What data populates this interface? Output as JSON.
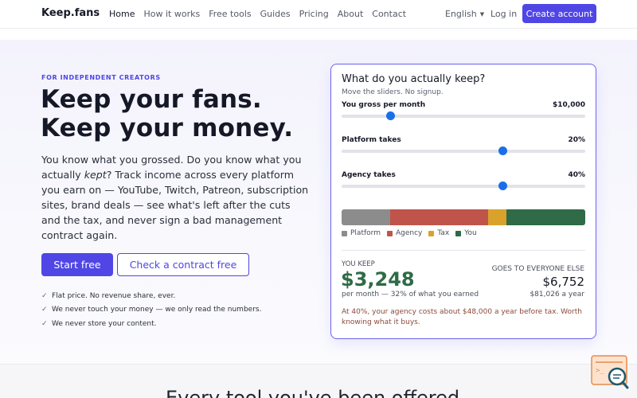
{
  "nav": {
    "logo": "Keep.fans",
    "links": [
      "Home",
      "How it works",
      "Free tools",
      "Guides",
      "Pricing",
      "About",
      "Contact"
    ],
    "language": "English",
    "login": "Log in",
    "create_account": "Create account"
  },
  "hero": {
    "eyebrow": "FOR INDEPENDENT CREATORS",
    "headline_line1": "Keep your fans.",
    "headline_line2": "Keep your money.",
    "body_part1": "You know what you grossed. Do you know what you actually ",
    "body_em": "kept",
    "body_part2": "? Track income across every platform you earn on — YouTube, Twitch, Patreon, subscription sites, brand deals — see what's left after the cuts and the tax, and never sign a bad management contract again.",
    "primary_cta": "Start free",
    "secondary_cta": "Check a contract free",
    "checks": [
      "Flat price. No revenue share, ever.",
      "We never touch your money — we only read the numbers.",
      "We never store your content."
    ]
  },
  "calculator": {
    "title": "What do you actually keep?",
    "subtitle": "Move the sliders. No signup.",
    "sliders": [
      {
        "label": "You gross per month",
        "value_text": "$10,000",
        "fraction": 0.2
      },
      {
        "label": "Platform takes",
        "value_text": "20%",
        "fraction": 0.661
      },
      {
        "label": "Agency takes",
        "value_text": "40%",
        "fraction": 0.661
      }
    ],
    "breakdown": [
      {
        "name": "Platform",
        "amount": 2000,
        "color": "#8c8c8c"
      },
      {
        "name": "Agency",
        "amount": 4000,
        "color": "#c0544a"
      },
      {
        "name": "Tax",
        "amount": 752,
        "color": "#d9a22b"
      },
      {
        "name": "You",
        "amount": 3248,
        "color": "#2e6b46"
      }
    ],
    "keep_label": "YOU KEEP",
    "keep_amount": "$3,248",
    "keep_note": "per month — 32% of what you earned",
    "else_label": "GOES TO EVERYONE ELSE",
    "else_amount": "$6,752",
    "else_note": "$81,026 a year",
    "warning": "At 40%, your agency costs about $48,000 a year before tax. Worth knowing what it buys."
  },
  "section2": {
    "title": "Every tool you've been offered"
  },
  "colors": {
    "accent": "#4f46e5",
    "keep_green": "#2e6b46",
    "slider_thumb": "#1a6fe8"
  }
}
